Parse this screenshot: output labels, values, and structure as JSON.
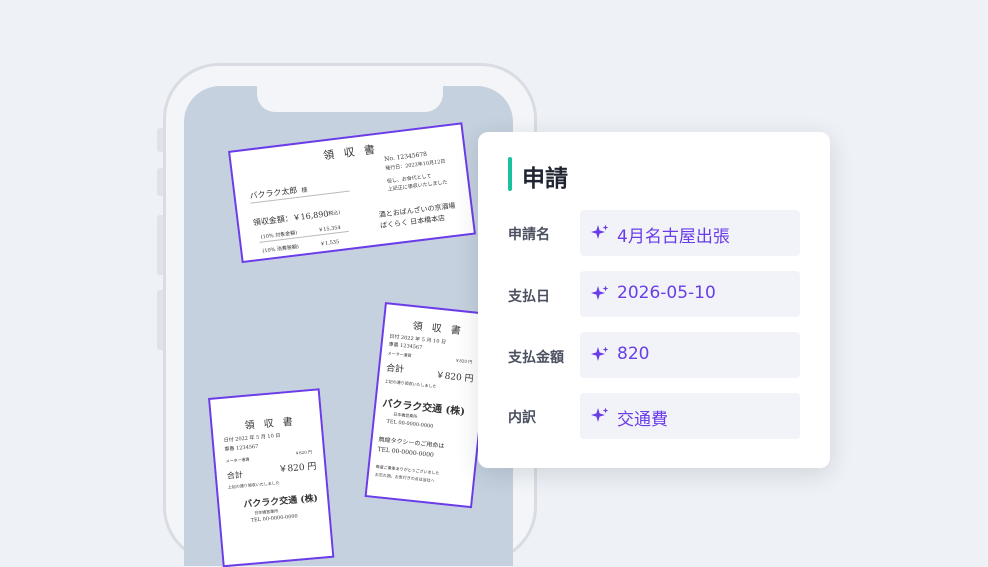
{
  "receipt_a": {
    "title": "領 収 書",
    "no": "No. 12345678",
    "issued": "発行日：2023年10月12日",
    "note1": "但し、お食代として",
    "note2": "上記正に領収いたしました",
    "recipient": "バクラク太郎",
    "honorific": "様",
    "amount": "領収金額：￥16,890",
    "amount_note": "(税込)",
    "tax1_label": "(10% 対象金額)",
    "tax1_value": "￥15,354",
    "tax2_label": "(10% 消費税額)",
    "tax2_value": "￥1,535",
    "shop1": "酒とおばんざいの京酒場",
    "shop2": "ばくらく 日本橋本店"
  },
  "receipt_b": {
    "title": "領 収 書",
    "date": "日付 2022 年 5 月 10 日",
    "car_no": "車番  1234567",
    "meter": "メーター運賃",
    "meter_value": "￥820 円",
    "total_label": "合計",
    "total": "￥820 円",
    "received": "上記の通り領収いたしました",
    "company": "バクラク交通 (株)",
    "office": "日本橋営業所",
    "tel": "TEL 00-0000-0000",
    "wireless": "無線タクシーのご用命は",
    "tel2": "TEL 00-0000-0000",
    "thanks1": "毎度ご乗車ありがとうございました",
    "thanks2": "お忘れ物、お気付きの点は当社へ"
  },
  "receipt_c": {
    "title": "領 収 書",
    "date": "日付 2022 年 5 月 10 日",
    "car_no": "車番  1234567",
    "meter": "メーター運賃",
    "meter_value": "￥820 円",
    "total_label": "合計",
    "total": "￥820 円",
    "received": "上記の通り領収いたしました",
    "company": "バクラク交通 (株)",
    "office": "日本橋営業所",
    "tel": "TEL 00-0000-0000"
  },
  "card": {
    "title": "申請",
    "fields": [
      {
        "label": "申請名",
        "value": "4月名古屋出張"
      },
      {
        "label": "支払日",
        "value": "2026-05-10"
      },
      {
        "label": "支払金額",
        "value": "820"
      },
      {
        "label": "内訳",
        "value": "交通費"
      }
    ]
  },
  "colors": {
    "accent": "#6a3de8",
    "title_bar": "#18c29c"
  },
  "icons": {
    "field_icon": "sparkle-icon"
  }
}
